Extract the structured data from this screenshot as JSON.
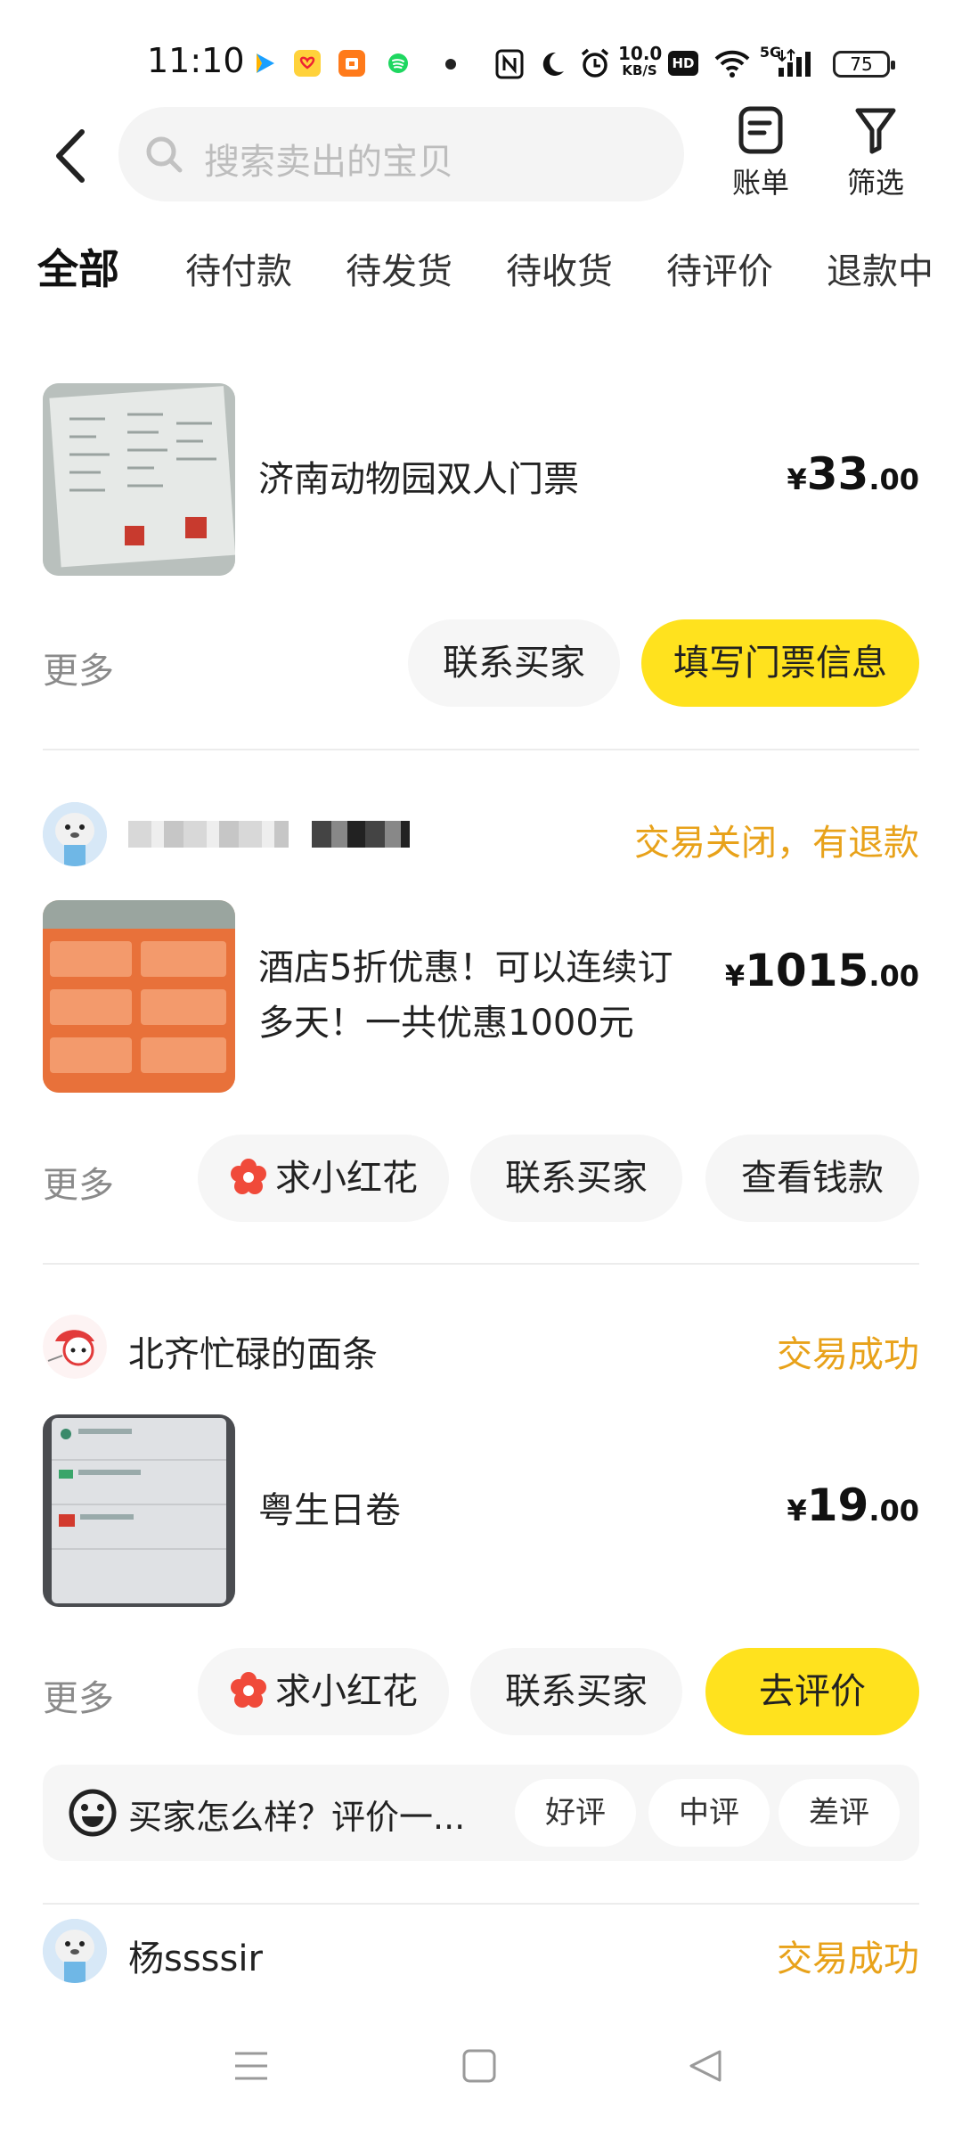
{
  "status_bar": {
    "time": "11:10",
    "net_speed_value": "10.0",
    "net_speed_unit": "KB/S",
    "hd": "HD",
    "signal": "5G",
    "battery": "75"
  },
  "header": {
    "search_placeholder": "搜索卖出的宝贝",
    "bill_label": "账单",
    "filter_label": "筛选"
  },
  "tabs": [
    "全部",
    "待付款",
    "待发货",
    "待收货",
    "待评价",
    "退款中"
  ],
  "orders": [
    {
      "title": "济南动物园双人门票",
      "price_symbol": "¥",
      "price_int": "33",
      "price_dec": ".00",
      "more": "更多",
      "buttons": [
        "联系买家",
        "填写门票信息"
      ]
    },
    {
      "status": "交易关闭，有退款",
      "title_line1": "酒店5折优惠！可以连续订",
      "title_line2": "多天！一共优惠1000元",
      "price_symbol": "¥",
      "price_int": "1015",
      "price_dec": ".00",
      "more": "更多",
      "buttons": [
        "求小红花",
        "联系买家",
        "查看钱款"
      ]
    },
    {
      "seller": "北齐忙碌的面条",
      "status": "交易成功",
      "title": "粤生日卷",
      "price_symbol": "¥",
      "price_int": "19",
      "price_dec": ".00",
      "more": "更多",
      "buttons": [
        "求小红花",
        "联系买家",
        "去评价"
      ],
      "rate_prompt": "买家怎么样？评价一...",
      "rate_options": [
        "好评",
        "中评",
        "差评"
      ]
    },
    {
      "seller": "杨ssssir",
      "status": "交易成功"
    }
  ],
  "colors": {
    "accent_yellow": "#ffe21e",
    "status_orange": "#e8a21a",
    "flower_red": "#f04a3a"
  }
}
